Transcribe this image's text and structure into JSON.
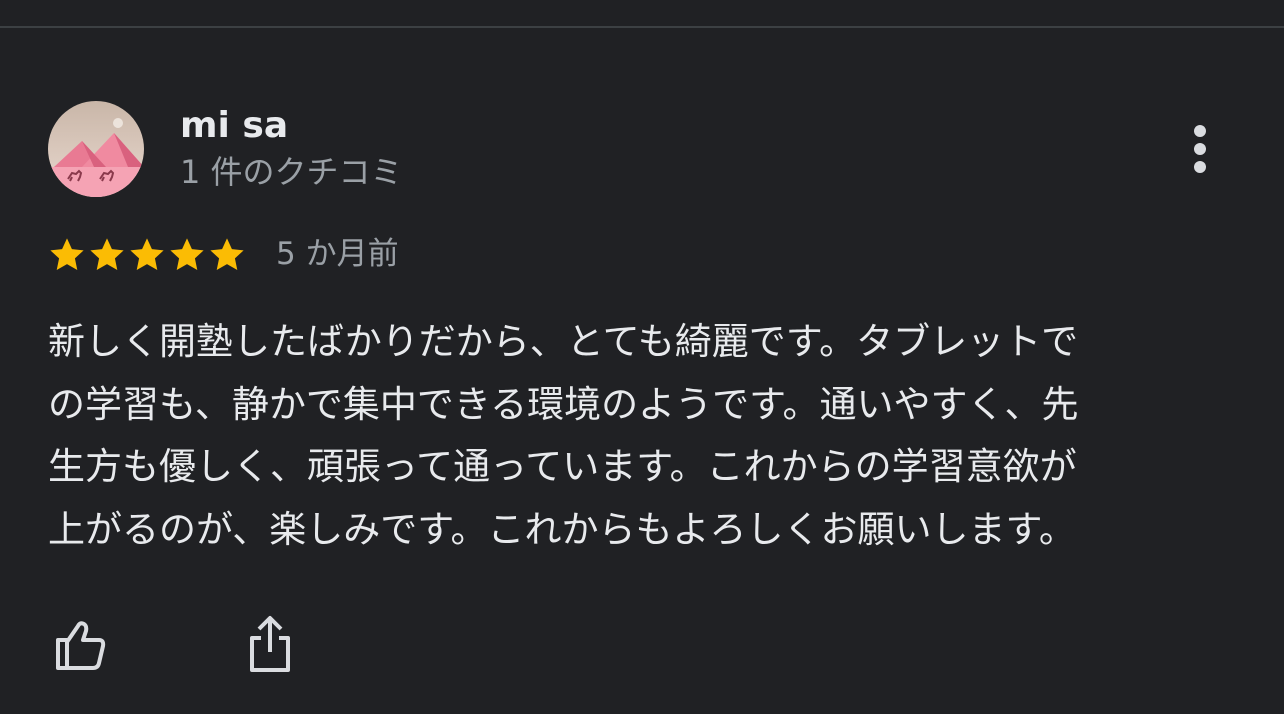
{
  "reviewer": {
    "name": "mi sa",
    "review_count": "1 件のクチコミ",
    "avatar_icon": "camel-pyramid-avatar-icon"
  },
  "rating": {
    "stars": 5,
    "max_stars": 5,
    "star_color": "#fbbc04",
    "relative_time": "5 か月前"
  },
  "review": {
    "text_lines": [
      "新しく開塾したばかりだから、とても綺麗です。タブレットで",
      "の学習も、静かで集中できる環境のようです。通いやすく、先",
      "生方も優しく、頑張って通っています。これからの学習意欲が",
      "上がるのが、楽しみです。これからもよろしくお願いします。"
    ]
  },
  "actions": {
    "more_icon": "more-vert-icon",
    "like_icon": "thumbs-up-icon",
    "share_icon": "share-icon"
  },
  "colors": {
    "background": "#202124",
    "primary_text": "#e8eaed",
    "secondary_text": "#9aa0a6",
    "icon": "#dadce0",
    "star": "#fbbc04"
  }
}
